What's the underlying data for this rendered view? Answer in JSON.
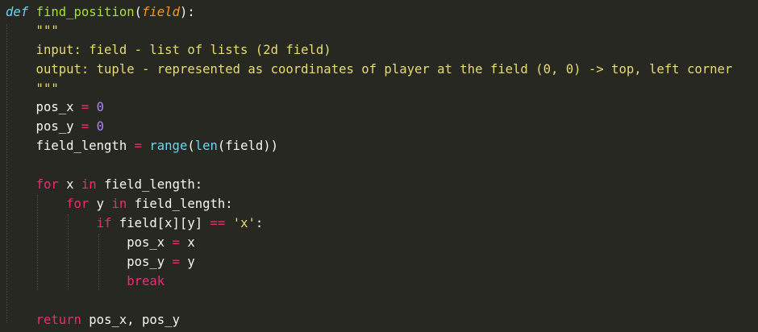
{
  "code": {
    "lines": [
      [
        {
          "t": "def",
          "k": "def"
        },
        {
          "t": " ",
          "k": "id"
        },
        {
          "t": "find_position",
          "k": "fn"
        },
        {
          "t": "(",
          "k": "id"
        },
        {
          "t": "field",
          "k": "param"
        },
        {
          "t": "):",
          "k": "id"
        }
      ],
      [
        {
          "t": "    \"\"\"",
          "k": "str"
        }
      ],
      [
        {
          "t": "    input: field - list of lists (2d field)",
          "k": "str"
        }
      ],
      [
        {
          "t": "    output: tuple - represented as coordinates of player at the field (0, 0) -> top, left corner",
          "k": "str"
        }
      ],
      [
        {
          "t": "    \"\"\"",
          "k": "str"
        }
      ],
      [
        {
          "t": "    pos_x ",
          "k": "id"
        },
        {
          "t": "=",
          "k": "op"
        },
        {
          "t": " ",
          "k": "id"
        },
        {
          "t": "0",
          "k": "num"
        }
      ],
      [
        {
          "t": "    pos_y ",
          "k": "id"
        },
        {
          "t": "=",
          "k": "op"
        },
        {
          "t": " ",
          "k": "id"
        },
        {
          "t": "0",
          "k": "num"
        }
      ],
      [
        {
          "t": "    field_length ",
          "k": "id"
        },
        {
          "t": "=",
          "k": "op"
        },
        {
          "t": " ",
          "k": "id"
        },
        {
          "t": "range",
          "k": "bi"
        },
        {
          "t": "(",
          "k": "id"
        },
        {
          "t": "len",
          "k": "bi"
        },
        {
          "t": "(field))",
          "k": "id"
        }
      ],
      [],
      [
        {
          "t": "    ",
          "k": "id"
        },
        {
          "t": "for",
          "k": "kw"
        },
        {
          "t": " x ",
          "k": "id"
        },
        {
          "t": "in",
          "k": "kw"
        },
        {
          "t": " field_length:",
          "k": "id"
        }
      ],
      [
        {
          "t": "        ",
          "k": "id"
        },
        {
          "t": "for",
          "k": "kw"
        },
        {
          "t": " y ",
          "k": "id"
        },
        {
          "t": "in",
          "k": "kw"
        },
        {
          "t": " field_length:",
          "k": "id"
        }
      ],
      [
        {
          "t": "            ",
          "k": "id"
        },
        {
          "t": "if",
          "k": "kw"
        },
        {
          "t": " field[x][y] ",
          "k": "id"
        },
        {
          "t": "==",
          "k": "op"
        },
        {
          "t": " ",
          "k": "id"
        },
        {
          "t": "'x'",
          "k": "str"
        },
        {
          "t": ":",
          "k": "id"
        }
      ],
      [
        {
          "t": "                pos_x ",
          "k": "id"
        },
        {
          "t": "=",
          "k": "op"
        },
        {
          "t": " x",
          "k": "id"
        }
      ],
      [
        {
          "t": "                pos_y ",
          "k": "id"
        },
        {
          "t": "=",
          "k": "op"
        },
        {
          "t": " y",
          "k": "id"
        }
      ],
      [
        {
          "t": "                ",
          "k": "id"
        },
        {
          "t": "break",
          "k": "kw"
        }
      ],
      [],
      [
        {
          "t": "    ",
          "k": "id"
        },
        {
          "t": "return",
          "k": "kw"
        },
        {
          "t": " pos_x, pos_y",
          "k": "id"
        }
      ]
    ]
  },
  "theme": {
    "background": "#272822",
    "keyword": "#f92672",
    "function": "#a6e22e",
    "parameter": "#fd971f",
    "number": "#ae81ff",
    "string": "#e6db74",
    "builtin": "#66d9ef"
  }
}
